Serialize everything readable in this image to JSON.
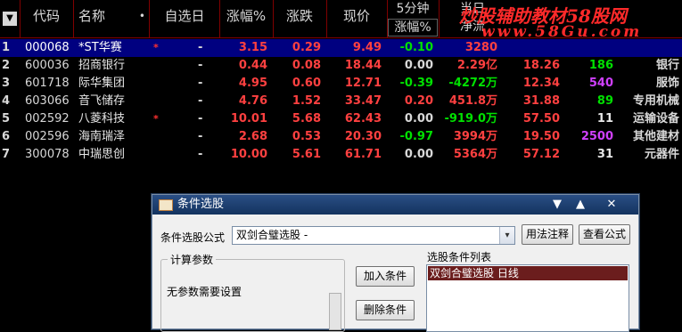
{
  "header": {
    "menu_glyph": "▼",
    "col_code": "代码",
    "col_name": "名称",
    "col_name_dot": "•",
    "col_watch": "自选日",
    "col_pct": "涨幅%",
    "col_chg": "涨跌",
    "col_price": "现价",
    "col_5min_top": "5分钟",
    "col_5min_sub": "涨幅%",
    "col_today_top": "当日",
    "col_today_sub": "净流"
  },
  "watermark": {
    "line1": "炒股辅助教材58股网",
    "line2": "www.58Gu.com"
  },
  "rows": [
    {
      "idx": "1",
      "code": "000068",
      "name": "*ST华赛",
      "mark": "*",
      "watch": "-",
      "pct": "3.15",
      "chg": "0.29",
      "price": "9.49",
      "m5": "-0.10",
      "flow": "3280",
      "c10": "",
      "c11": "",
      "c12": ""
    },
    {
      "idx": "2",
      "code": "600036",
      "name": "招商银行",
      "mark": "",
      "watch": "-",
      "pct": "0.44",
      "chg": "0.08",
      "price": "18.44",
      "m5": "0.00",
      "flow": "2.29亿",
      "c10": "18.26",
      "c11": "186",
      "c12": "银行"
    },
    {
      "idx": "3",
      "code": "601718",
      "name": "际华集团",
      "mark": "",
      "watch": "-",
      "pct": "4.95",
      "chg": "0.60",
      "price": "12.71",
      "m5": "-0.39",
      "flow": "-4272万",
      "c10": "12.34",
      "c11": "540",
      "c12": "服饰"
    },
    {
      "idx": "4",
      "code": "603066",
      "name": "音飞储存",
      "mark": "",
      "watch": "-",
      "pct": "4.76",
      "chg": "1.52",
      "price": "33.47",
      "m5": "0.20",
      "flow": "451.8万",
      "c10": "31.88",
      "c11": "89",
      "c12": "专用机械"
    },
    {
      "idx": "5",
      "code": "002592",
      "name": "八菱科技",
      "mark": "*",
      "watch": "-",
      "pct": "10.01",
      "chg": "5.68",
      "price": "62.43",
      "m5": "0.00",
      "flow": "-919.0万",
      "c10": "57.50",
      "c11": "11",
      "c12": "运输设备"
    },
    {
      "idx": "6",
      "code": "002596",
      "name": "海南瑞泽",
      "mark": "",
      "watch": "-",
      "pct": "2.68",
      "chg": "0.53",
      "price": "20.30",
      "m5": "-0.97",
      "flow": "3994万",
      "c10": "19.50",
      "c11": "2500",
      "c12": "其他建材"
    },
    {
      "idx": "7",
      "code": "300078",
      "name": "中瑞思创",
      "mark": "",
      "watch": "-",
      "pct": "10.00",
      "chg": "5.61",
      "price": "61.71",
      "m5": "0.00",
      "flow": "5364万",
      "c10": "57.12",
      "c11": "31",
      "c12": "元器件"
    }
  ],
  "dialog": {
    "title": "条件选股",
    "btn_dropdown": "▼",
    "btn_min": "▲",
    "btn_close": "✕",
    "formula_label": "条件选股公式",
    "formula_value": "双剑合璧选股 -",
    "combo_arrow": "▾",
    "btn_usage": "用法注释",
    "btn_view": "查看公式",
    "group_params": "计算参数",
    "no_params": "无参数需要设置",
    "btn_add": "加入条件",
    "btn_remove": "删除条件",
    "list_label": "选股条件列表",
    "list_items": [
      "双剑合璧选股  日线"
    ]
  }
}
